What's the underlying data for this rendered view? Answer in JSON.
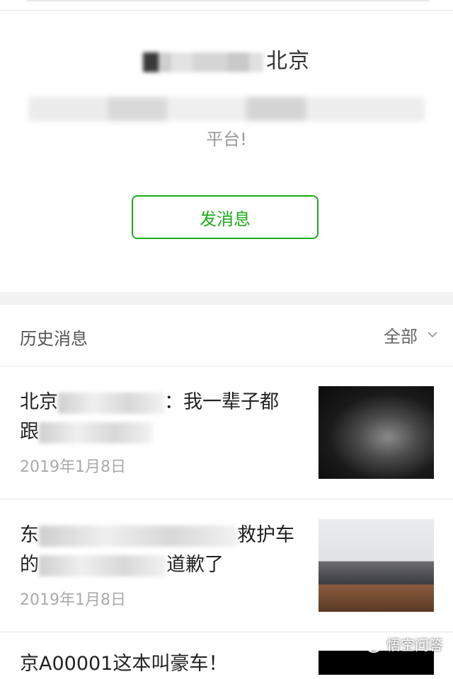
{
  "profile": {
    "name_suffix": "北京",
    "description_end": "平台!"
  },
  "actions": {
    "send_message_label": "发消息"
  },
  "history": {
    "title": "历史消息",
    "filter_label": "全部",
    "articles": [
      {
        "title_start": "北京",
        "title_mid": "：我一辈子都",
        "title_line2": "跟",
        "date": "2019年1月8日",
        "icon": "photo-dark-portrait"
      },
      {
        "title_start": "东",
        "title_mid": "救护车",
        "title_line2_a": "的",
        "title_line2_b": "道歉了",
        "date": "2019年1月8日",
        "icon": "photo-police-office"
      },
      {
        "title_start": "京A00001这本叫豪车！",
        "icon": "photo-dark"
      }
    ]
  },
  "watermark": {
    "text": "悟空问答"
  },
  "colors": {
    "accent_green": "#1aad19",
    "divider": "#e5e5e5",
    "date_gray": "#aaaaaa"
  }
}
